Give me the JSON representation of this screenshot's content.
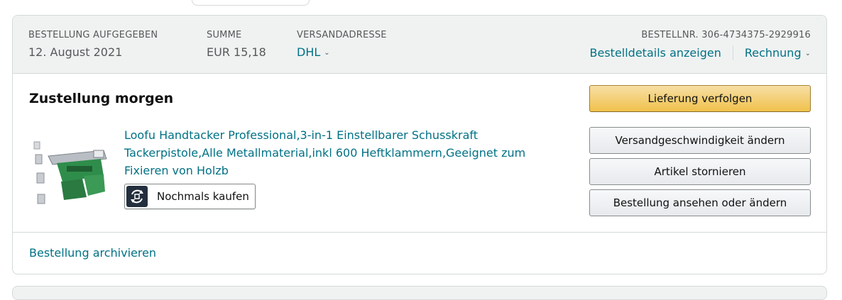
{
  "order": {
    "placed_label": "BESTELLUNG AUFGEGEBEN",
    "placed_date": "12. August 2021",
    "total_label": "SUMME",
    "total_value": "EUR 15,18",
    "shipping_label": "VERSANDADRESSE",
    "shipping_value": "DHL",
    "order_number": "BESTELLNR. 306-4734375-2929916",
    "details_link": "Bestelldetails anzeigen",
    "invoice_link": "Rechnung"
  },
  "shipment": {
    "status_title": "Zustellung morgen",
    "product_title": "Loofu Handtacker Professional,3-in-1 Einstellbarer Schusskraft Tackerpistole,Alle Metallmaterial,inkl 600 Heftklammern,Geeignet zum Fixieren von Holzb",
    "buy_again_label": "Nochmals kaufen"
  },
  "actions": {
    "track": "Lieferung verfolgen",
    "change_speed": "Versandgeschwindigkeit ändern",
    "cancel": "Artikel stornieren",
    "view_edit": "Bestellung ansehen oder ändern"
  },
  "footer": {
    "archive_link": "Bestellung archivieren"
  },
  "colors": {
    "link": "#007185",
    "header_bg": "#f0f2f2",
    "primary_button": "#f0c14b"
  },
  "icons": {
    "dropdown": "chevron-down-icon",
    "buy_again": "buy-again-icon"
  }
}
